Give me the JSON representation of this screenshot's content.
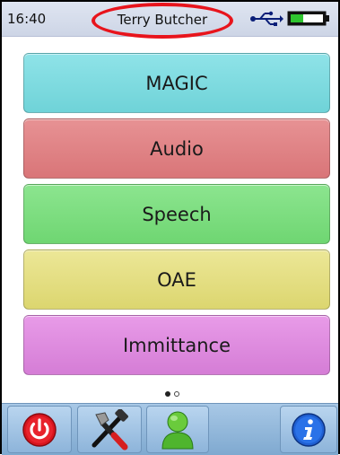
{
  "status_bar": {
    "time": "16:40",
    "user_name": "Terry Butcher",
    "usb_icon": "usb-icon",
    "battery_icon": "battery-icon",
    "battery_color": "#2fc52f"
  },
  "menu": [
    {
      "label": "MAGIC",
      "color": "#7ddbe0"
    },
    {
      "label": "Audio",
      "color": "#df8285"
    },
    {
      "label": "Speech",
      "color": "#7ddd80"
    },
    {
      "label": "OAE",
      "color": "#e4de82"
    },
    {
      "label": "Immittance",
      "color": "#df8bdf"
    }
  ],
  "pager": {
    "current_page": 1,
    "total_pages": 2
  },
  "toolbar": {
    "icons": [
      "power-icon",
      "tools-icon",
      "user-icon",
      "info-icon"
    ]
  },
  "highlight_color": "#e8141c"
}
